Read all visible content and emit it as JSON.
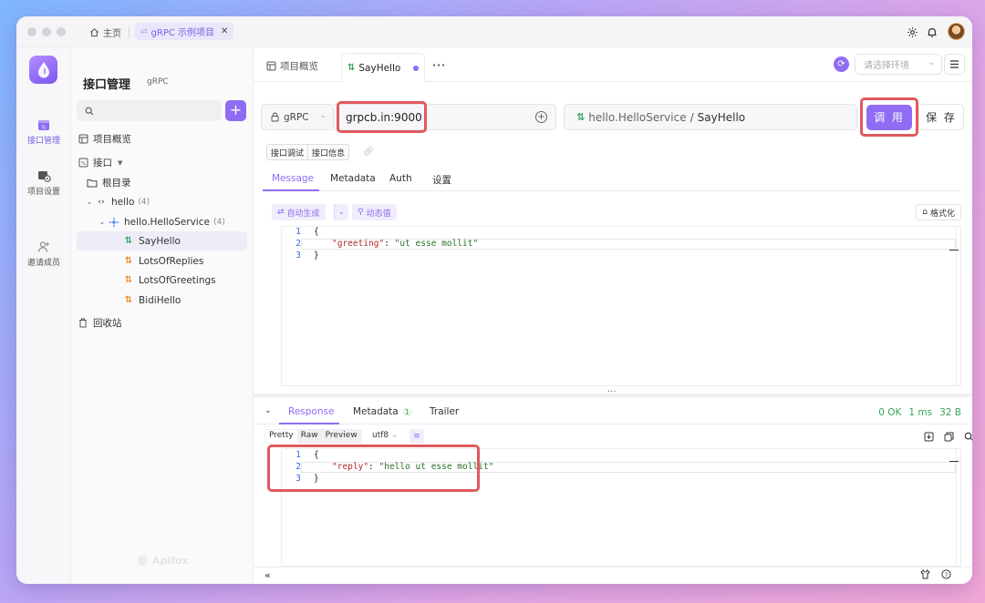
{
  "titlebar": {
    "home_label": "主页",
    "project_tab_label": "gRPC 示例项目"
  },
  "rail": {
    "items": [
      {
        "label": "接口管理",
        "icon": "api-icon"
      },
      {
        "label": "项目设置",
        "icon": "project-settings-icon"
      },
      {
        "label": "邀请成员",
        "icon": "invite-member-icon"
      }
    ],
    "watermark": "Apifox"
  },
  "sidebar": {
    "title": "接口管理",
    "subtitle": "gRPC",
    "search_placeholder": "",
    "add_label": "+",
    "overview_label": "项目概览",
    "interfaces_label": "接口",
    "root_label": "根目录",
    "package": {
      "label": "hello",
      "count": "(4)"
    },
    "service": {
      "label": "hello.HelloService",
      "count": "(4)"
    },
    "methods": [
      {
        "label": "SayHello",
        "type": "unary"
      },
      {
        "label": "LotsOfReplies",
        "type": "server-stream"
      },
      {
        "label": "LotsOfGreetings",
        "type": "client-stream"
      },
      {
        "label": "BidiHello",
        "type": "bidi-stream"
      }
    ],
    "trash_label": "回收站"
  },
  "topbar": {
    "tabs": [
      {
        "label": "项目概览"
      },
      {
        "label": "SayHello"
      }
    ],
    "more_label": "···",
    "env_placeholder": "请选择环境"
  },
  "request": {
    "protocol": "gRPC",
    "host": "grpcb.in:9000",
    "service_path": "hello.HelloService",
    "separator": "/",
    "method": "SayHello",
    "invoke_label": "调 用",
    "save_label": "保 存"
  },
  "request_view_tabs": [
    "接口调试",
    "接口信息"
  ],
  "request_tabs": [
    "Message",
    "Metadata",
    "Auth",
    "设置"
  ],
  "editor": {
    "auto_generate_label": "自动生成",
    "dynamic_value_label": "动态值",
    "format_label": "格式化",
    "lines": [
      {
        "num": "1",
        "text": "{"
      },
      {
        "num": "2",
        "key": "\"greeting\"",
        "sep": ": ",
        "value": "\"ut esse mollit\""
      },
      {
        "num": "3",
        "text": "}"
      }
    ]
  },
  "response": {
    "tabs": [
      {
        "label": "Response"
      },
      {
        "label": "Metadata",
        "badge": "1"
      },
      {
        "label": "Trailer"
      }
    ],
    "status": "0 OK",
    "time": "1 ms",
    "size": "32 B",
    "format_modes": [
      "Pretty",
      "Raw",
      "Preview"
    ],
    "encoding": "utf8",
    "lines": [
      {
        "num": "1",
        "text": "{"
      },
      {
        "num": "2",
        "key": "\"reply\"",
        "sep": ": ",
        "value": "\"hello ut esse mollit\""
      },
      {
        "num": "3",
        "text": "}"
      }
    ]
  },
  "colors": {
    "accent": "#8f6cf3",
    "success": "#3aa55a",
    "highlight": "#e0595e"
  }
}
